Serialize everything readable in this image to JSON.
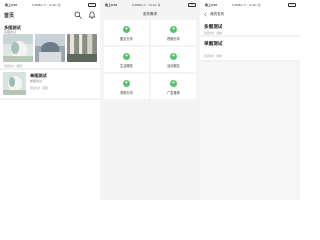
{
  "status": {
    "time": "晚上9:59",
    "net": "0.4KB/s ⊙ ◔ ▾ᵢₗ 4G 令",
    "battery": "72"
  },
  "panel_a": {
    "header_title": "首页",
    "post1": {
      "title": "多图测试",
      "subtitle": "多图测试",
      "meta": "测试用户 · 刚刚"
    },
    "post2": {
      "title": "单图测试",
      "subtitle": "单图测试",
      "meta": "测试用户 · 刚刚"
    }
  },
  "panel_b": {
    "page_title": "发布需求",
    "cards": [
      {
        "label": "图文分享",
        "icon": "plus-icon"
      },
      {
        "label": "视频分享",
        "icon": "plus-icon"
      },
      {
        "label": "生活服务",
        "icon": "plus-icon"
      },
      {
        "label": "活动报名",
        "icon": "plus-icon"
      },
      {
        "label": "求购分享",
        "icon": "plus-icon"
      },
      {
        "label": "广告推荐",
        "icon": "plus-icon"
      }
    ]
  },
  "panel_c": {
    "nav_label": "我的发布",
    "item1": {
      "title": "多图测试",
      "meta": "测试用户 · 刚刚"
    },
    "item2": {
      "title": "单图测试",
      "meta": "测试用户 · 刚刚"
    }
  },
  "colors": {
    "accent_green": "#58c26d",
    "divider": "#f1f1f1",
    "panel_b_bg": "#f4f4f4"
  }
}
